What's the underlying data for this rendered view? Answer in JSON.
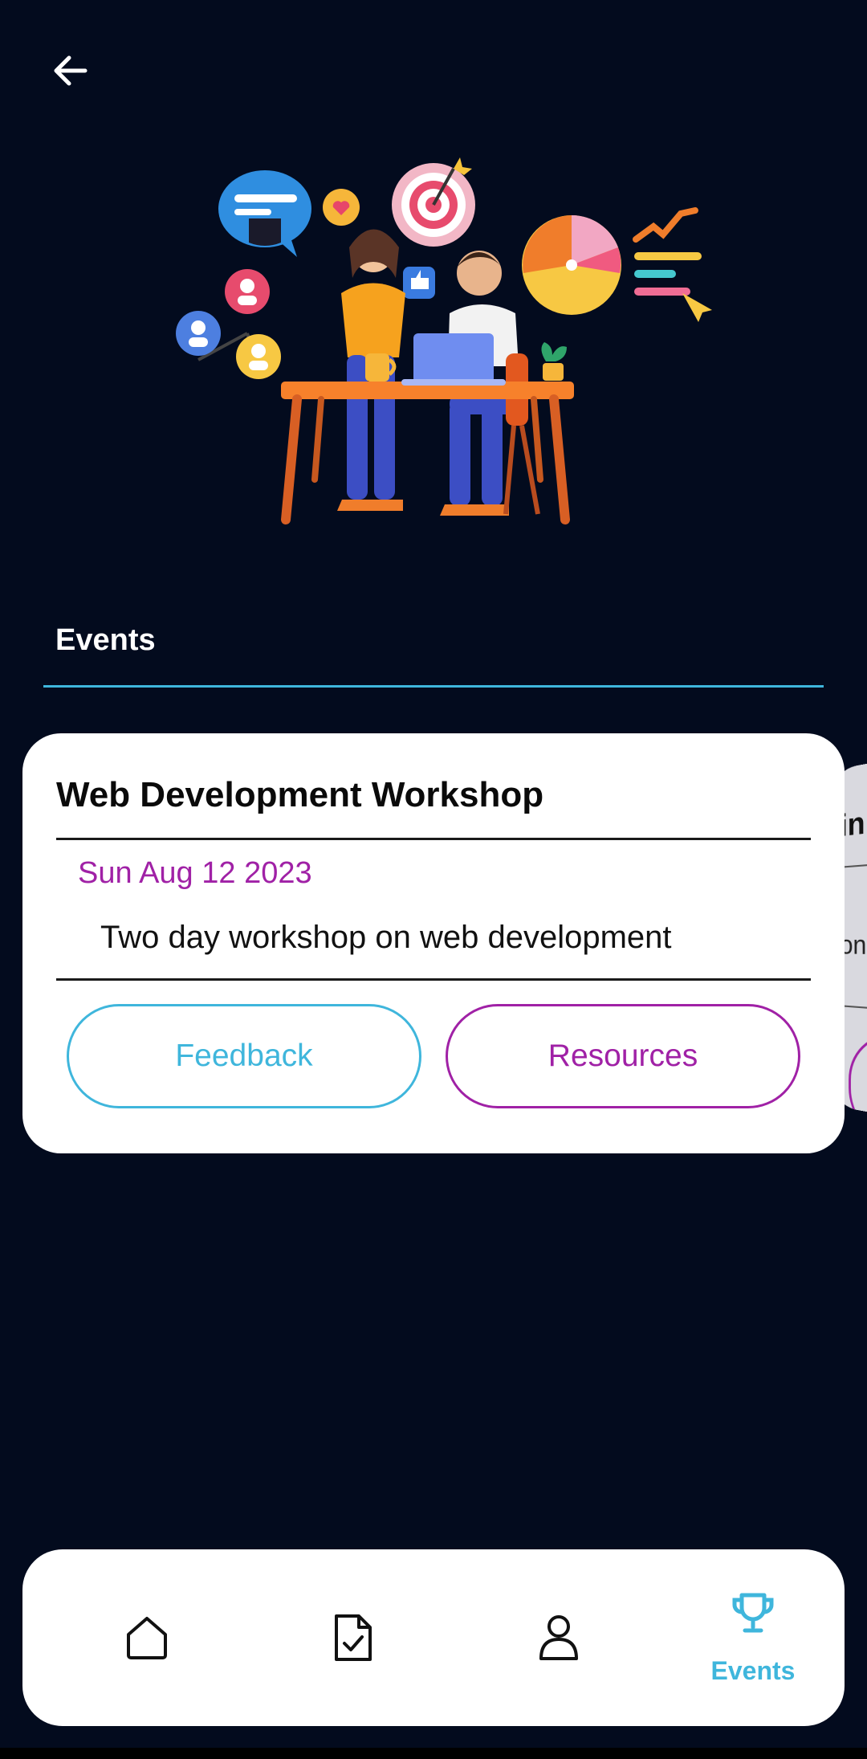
{
  "header": {
    "back_icon": "arrow-left-icon"
  },
  "hero": {
    "illustration": "team-working-at-desk-illustration"
  },
  "section": {
    "title": "Events"
  },
  "event_card": {
    "title": "Web Development Workshop",
    "date": "Sun Aug 12 2023",
    "description": "Two day workshop on web development",
    "feedback_label": "Feedback",
    "resources_label": "Resources"
  },
  "next_card_peek": {
    "title_fragment": "in",
    "desc_fragment": "on"
  },
  "bottom_nav": {
    "items": [
      {
        "icon": "home-icon",
        "label": ""
      },
      {
        "icon": "task-document-icon",
        "label": ""
      },
      {
        "icon": "user-icon",
        "label": ""
      },
      {
        "icon": "trophy-icon",
        "label": "Events",
        "active": true
      }
    ]
  },
  "colors": {
    "background": "#030b1e",
    "accent_blue": "#3fb6dc",
    "accent_purple": "#a021a6",
    "card": "#ffffff"
  }
}
